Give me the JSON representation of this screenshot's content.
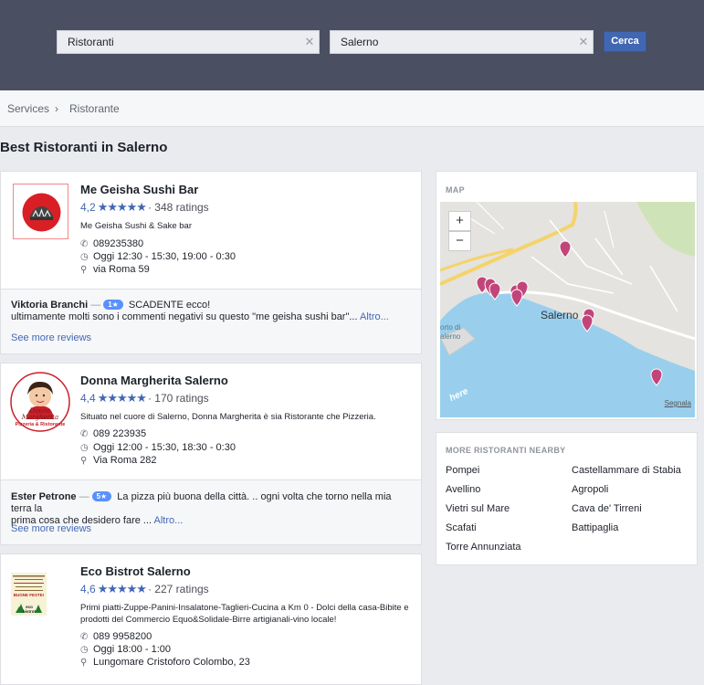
{
  "search": {
    "query": "Ristoranti",
    "location": "Salerno",
    "button_label": "Cerca"
  },
  "breadcrumb": {
    "root": "Services",
    "separator": "›",
    "current": "Ristorante"
  },
  "page_title": "Best Ristoranti in Salerno",
  "listings": [
    {
      "name": "Me Geisha Sushi Bar",
      "rating": "4,2",
      "stars": "★★★★★",
      "ratings_count": "· 348 ratings",
      "description": "Me Geisha Sushi & Sake bar",
      "phone": "089235380",
      "hours": "Oggi 12:30 - 15:30, 19:00 - 0:30",
      "address": "via Roma 59",
      "review": {
        "author": "Viktoria Branchi",
        "dash": "—",
        "badge": "1★",
        "text_line1": "SCADENTE ecco!",
        "text_line2": "ultimamente molti sono i commenti negativi su questo \"me geisha sushi bar\"...",
        "more": "Altro..."
      },
      "see_more": "See more reviews"
    },
    {
      "name": "Donna Margherita Salerno",
      "rating": "4,4",
      "stars": "★★★★★",
      "ratings_count": "· 170 ratings",
      "description": "Situato nel cuore di Salerno, Donna Margherita è sia Ristorante che Pizzeria.",
      "phone": "089 223935",
      "hours": "Oggi 12:00 - 15:30, 18:30 - 0:30",
      "address": "Via Roma 282",
      "logo_text": {
        "top": "Donna",
        "mid": "Margherita",
        "bottom": "Pizzeria & Ristorante"
      },
      "review": {
        "author": "Ester Petrone",
        "dash": "—",
        "badge": "5★",
        "text_line1": "La pizza più buona della città. .. ogni volta che torno nella mia terra la",
        "text_line2": "prima cosa che desidero fare ...",
        "more": "Altro..."
      },
      "see_more": "See more reviews"
    },
    {
      "name": "Eco Bistrot Salerno",
      "rating": "4,6",
      "stars": "★★★★★",
      "ratings_count": "· 227 ratings",
      "description": "Primi piatti-Zuppe-Panini-Insalatone-Taglieri-Cucina a Km 0 - Dolci della casa-Bibite e prodotti del Commercio Equo&Solidale-Birre artigianali-vino locale!",
      "phone": "089 9958200",
      "hours": "Oggi 18:00 - 1:00",
      "address": "Lungomare Cristoforo Colombo, 23",
      "logo_text": {
        "banner": "BUONE FESTE!",
        "brand": "eco bistrot"
      }
    }
  ],
  "map": {
    "title": "MAP",
    "zoom_in": "+",
    "zoom_out": "−",
    "city_label": "Salerno",
    "port_label": "orto di\nalerno",
    "watermark": "here",
    "report_link": "Segnala"
  },
  "nearby": {
    "title": "MORE RISTORANTI NEARBY",
    "left": [
      "Pompei",
      "Avellino",
      "Vietri sul Mare",
      "Scafati",
      "Torre Annunziata"
    ],
    "right": [
      "Castellammare di Stabia",
      "Agropoli",
      "Cava de' Tirreni",
      "Battipaglia"
    ]
  },
  "colors": {
    "header": "#4b4f62",
    "accent": "#4267b2",
    "pin": "#c2457a",
    "sea": "#99cfed"
  },
  "icons": {
    "phone": "phone-icon",
    "clock": "clock-icon",
    "pin": "map-pin-icon",
    "clear": "clear-icon"
  }
}
